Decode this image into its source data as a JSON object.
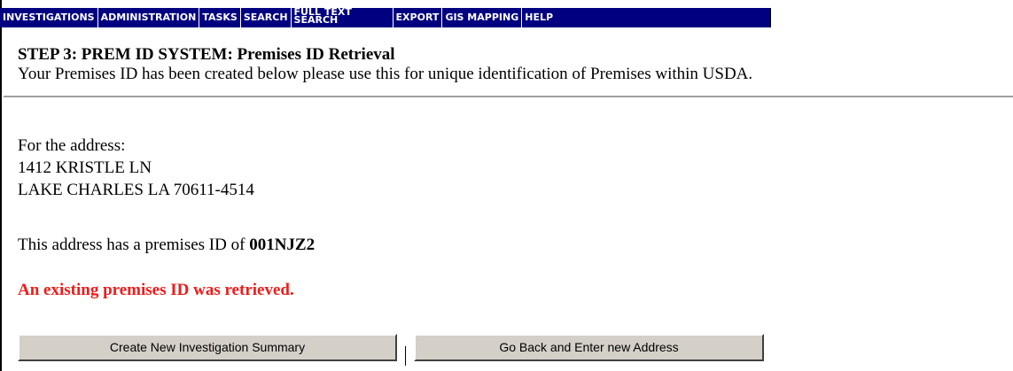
{
  "nav": {
    "items": [
      {
        "label": "INVESTIGATIONS"
      },
      {
        "label": "ADMINISTRATION"
      },
      {
        "label": "TASKS"
      },
      {
        "label": "SEARCH"
      },
      {
        "label_line1": "FULL TEXT",
        "label_line2": "SEARCH"
      },
      {
        "label": "EXPORT"
      },
      {
        "label": "GIS MAPPING"
      },
      {
        "label": "HELP"
      }
    ],
    "background": "#000080",
    "text_color": "#ffffff"
  },
  "page": {
    "title": "STEP 3: PREM ID SYSTEM: Premises ID Retrieval",
    "subtitle": "Your Premises ID has been created below please use this for unique identification of Premises within USDA."
  },
  "address": {
    "intro": "For the address:",
    "line1": "1412 KRISTLE LN",
    "line2": "LAKE CHARLES LA 70611-4514"
  },
  "premises": {
    "prefix": "This address has a premises ID of ",
    "id": "001NJZ2"
  },
  "status": {
    "message": "An existing premises ID was retrieved.",
    "color": "#ee1c1c"
  },
  "buttons": {
    "create_label": "Create New Investigation Summary",
    "back_label": "Go Back and Enter new Address"
  }
}
